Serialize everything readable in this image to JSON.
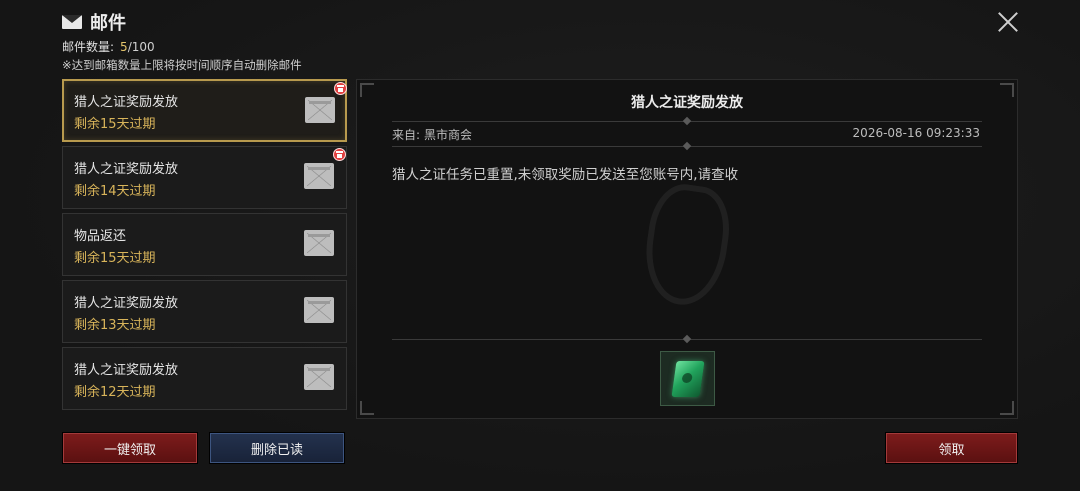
{
  "header": {
    "title": "邮件",
    "count_label": "邮件数量:",
    "count_value": "5",
    "count_total": "/100",
    "note": "※达到邮箱数量上限将按时间顺序自动删除邮件"
  },
  "mails": [
    {
      "title": "猎人之证奖励发放",
      "expiry": "剩余15天过期",
      "selected": true,
      "has_gift": true
    },
    {
      "title": "猎人之证奖励发放",
      "expiry": "剩余14天过期",
      "selected": false,
      "has_gift": true
    },
    {
      "title": "物品返还",
      "expiry": "剩余15天过期",
      "selected": false,
      "has_gift": false
    },
    {
      "title": "猎人之证奖励发放",
      "expiry": "剩余13天过期",
      "selected": false,
      "has_gift": false
    },
    {
      "title": "猎人之证奖励发放",
      "expiry": "剩余12天过期",
      "selected": false,
      "has_gift": false
    }
  ],
  "detail": {
    "title": "猎人之证奖励发放",
    "from_label": "来自:",
    "from_value": "黑市商会",
    "date": "2026-08-16 09:23:33",
    "body": "猎人之证任务已重置,未领取奖励已发送至您账号内,请查收",
    "reward_icon": "green-card-icon"
  },
  "buttons": {
    "claim_all": "一键领取",
    "delete_read": "删除已读",
    "claim": "领取"
  },
  "colors": {
    "accent_gold": "#d8b45a",
    "selected_border": "#b89a4e",
    "red_button": "#7e1c1c",
    "blue_button": "#24324e"
  }
}
